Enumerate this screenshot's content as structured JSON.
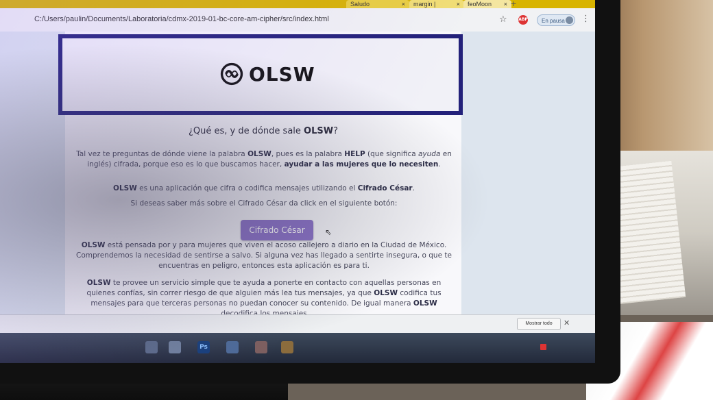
{
  "colors": {
    "header_border": "#23217a",
    "cta_bg": "#8c72c9",
    "tab_strip": "#d8b400",
    "page_bg": "#f8f8fb"
  },
  "browser": {
    "url": "C:/Users/paulin/Documents/Laboratoria/cdmx-2019-01-bc-core-am-cipher/src/index.html",
    "tabs": [
      {
        "label": "Saludo"
      },
      {
        "label": "margin |"
      },
      {
        "label": "feoMoon"
      }
    ],
    "profile_button": "En pausa",
    "extension_badge": "ABP",
    "icons": [
      "star-icon",
      "menu-kebab-icon",
      "avatar-icon"
    ]
  },
  "page": {
    "logo_text": "OLSW",
    "logo_icon": "olsw-logo-icon",
    "section_title_prefix": "¿Qué es, y de dónde sale ",
    "section_title_brand": "OLSW",
    "section_title_suffix": "?",
    "p1": {
      "a": "Tal vez te preguntas de dónde viene la palabra ",
      "brand": "OLSW",
      "b": ", pues es la palabra ",
      "help": "HELP",
      "c": " (que significa ",
      "ayuda": "ayuda",
      "d": " en inglés) cifrada, porque eso es lo que buscamos hacer, ",
      "e": "ayudar a las mujeres que lo necesiten",
      "f": "."
    },
    "p2": {
      "brand": "OLSW",
      "a": " es una aplicación que cifra o codifica mensajes utilizando el ",
      "cesar": "Cifrado César",
      "b": "."
    },
    "p3": "Si deseas saber más sobre el Cifrado César da click en el siguiente botón:",
    "cta_label": "Cifrado César",
    "p4": {
      "brand": "OLSW",
      "a": " está pensada por y para mujeres que viven el acoso callejero a diario en la Ciudad de México. Comprendemos la necesidad de sentirse a salvo. Si alguna vez has llegado a sentirte insegura, o que te encuentras en peligro, entonces esta aplicación es para ti."
    },
    "p5": {
      "brand": "OLSW",
      "a": " te provee un servicio simple que te ayuda a ponerte en contacto con aquellas personas en quienes confías, sin correr riesgo de que alguien más lea tus mensajes, ya que ",
      "brand2": "OLSW",
      "b": " codifica tus mensajes para que terceras personas no puedan conocer su contenido. De igual manera ",
      "brand3": "OLSW",
      "c": " decodifica los mensajes"
    }
  },
  "downloads": {
    "show_all": "Mostrar todo"
  },
  "taskbar": {
    "ps_label": "Ps"
  }
}
